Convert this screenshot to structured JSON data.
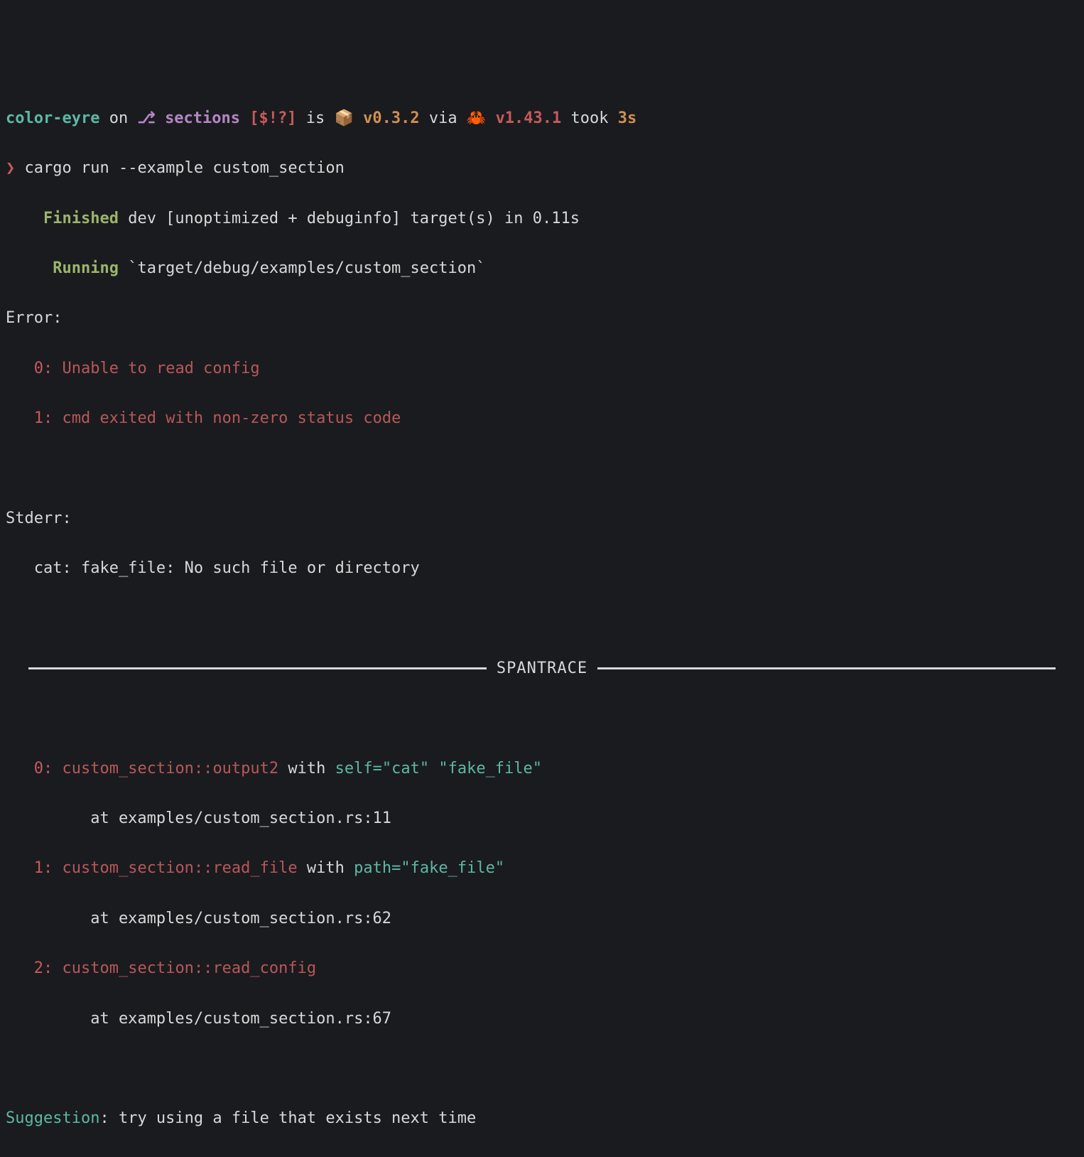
{
  "prompt": {
    "project": "color-eyre",
    "on": "on",
    "branch_icon": "⎇",
    "branch": "sections",
    "vcs_status": "[$!?]",
    "is": "is",
    "pkg_icon": "📦",
    "pkg_version": "v0.3.2",
    "via": "via",
    "rust_icon": "🦀",
    "rust_version": "v1.43.1",
    "took": "took",
    "duration": "3s",
    "caret": "❯",
    "command": "cargo run --example custom_section"
  },
  "cargo": {
    "finished_label": "Finished",
    "finished_rest": " dev [unoptimized + debuginfo] target(s) in 0.11s",
    "running_label": "Running",
    "running_rest": " `target/debug/examples/custom_section`"
  },
  "error": {
    "header": "Error:",
    "items": [
      {
        "n": "0:",
        "msg": "Unable to read config"
      },
      {
        "n": "1:",
        "msg": "cmd exited with non-zero status code"
      }
    ]
  },
  "stderr": {
    "header": "Stderr:",
    "body": "   cat: fake_file: No such file or directory"
  },
  "divider": "SPANTRACE",
  "trace": [
    {
      "n": "0:",
      "module": "custom_section",
      "sep": "::",
      "func": "output2",
      "with": " with ",
      "kv1": "self=\"cat\"",
      "rest": " \"fake_file\"",
      "at": "         at examples/custom_section.rs:11"
    },
    {
      "n": "1:",
      "module": "custom_section",
      "sep": "::",
      "func": "read_file",
      "with": " with ",
      "kv1": "path=\"fake_file\"",
      "rest": "",
      "at": "         at examples/custom_section.rs:62"
    },
    {
      "n": "2:",
      "module": "custom_section",
      "sep": "::",
      "func": "read_config",
      "with": "",
      "kv1": "",
      "rest": "",
      "at": "         at examples/custom_section.rs:67"
    }
  ],
  "suggestion": {
    "label": "Suggestion",
    "colon": ": ",
    "body": "try using a file that exists next time"
  }
}
